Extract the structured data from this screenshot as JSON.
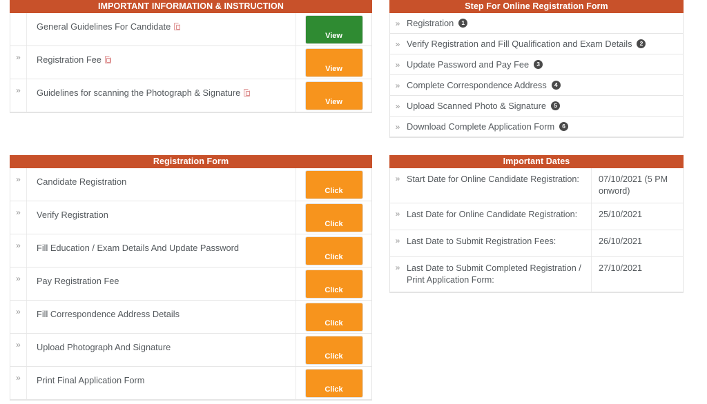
{
  "colors": {
    "header_bar": "#c8512a",
    "button_orange": "#f7941d",
    "button_green": "#2f8b32",
    "text": "#555a5e",
    "badge": "#4a4a4a",
    "page_background": "#ffffff"
  },
  "instructions": {
    "title": "IMPORTANT INFORMATION & INSTRUCTION",
    "rows": [
      {
        "marker": "",
        "label": "General Guidelines For Candidate",
        "has_pdf_icon": true,
        "button_label": "View",
        "button_color": "green"
      },
      {
        "marker": "»",
        "label": "Registration Fee",
        "has_pdf_icon": true,
        "button_label": "View",
        "button_color": "orange"
      },
      {
        "marker": "»",
        "label": "Guidelines for scanning the Photograph & Signature",
        "has_pdf_icon": true,
        "button_label": "View",
        "button_color": "orange"
      }
    ]
  },
  "steps": {
    "title": "Step For Online Registration Form",
    "rows": [
      {
        "marker": "»",
        "label": "Registration",
        "number": "1"
      },
      {
        "marker": "»",
        "label": "Verify Registration and Fill Qualification and Exam Details",
        "number": "2"
      },
      {
        "marker": "»",
        "label": "Update Password and Pay Fee",
        "number": "3"
      },
      {
        "marker": "»",
        "label": "Complete Correspondence Address",
        "number": "4"
      },
      {
        "marker": "»",
        "label": "Upload Scanned Photo & Signature",
        "number": "5"
      },
      {
        "marker": "»",
        "label": "Download Complete Application Form",
        "number": "6"
      }
    ]
  },
  "registration_form": {
    "title": "Registration Form",
    "rows": [
      {
        "marker": "»",
        "label": "Candidate Registration",
        "button_label": "Click"
      },
      {
        "marker": "»",
        "label": "Verify Registration",
        "button_label": "Click"
      },
      {
        "marker": "»",
        "label": "Fill Education / Exam Details And Update Password",
        "button_label": "Click"
      },
      {
        "marker": "»",
        "label": "Pay Registration Fee",
        "button_label": "Click"
      },
      {
        "marker": "»",
        "label": "Fill Correspondence Address Details",
        "button_label": "Click"
      },
      {
        "marker": "»",
        "label": "Upload Photograph And Signature",
        "button_label": "Click"
      },
      {
        "marker": "»",
        "label": "Print Final Application Form",
        "button_label": "Click"
      }
    ]
  },
  "important_dates": {
    "title": "Important Dates",
    "rows": [
      {
        "marker": "»",
        "label": "Start Date for Online Candidate Registration:",
        "value": "07/10/2021 (5 PM onword)"
      },
      {
        "marker": "»",
        "label": "Last Date for Online Candidate Registration:",
        "value": "25/10/2021"
      },
      {
        "marker": "»",
        "label": "Last Date to Submit Registration Fees:",
        "value": "26/10/2021"
      },
      {
        "marker": "»",
        "label": "Last Date to Submit Completed Registration / Print Application Form:",
        "value": "27/10/2021"
      }
    ]
  }
}
